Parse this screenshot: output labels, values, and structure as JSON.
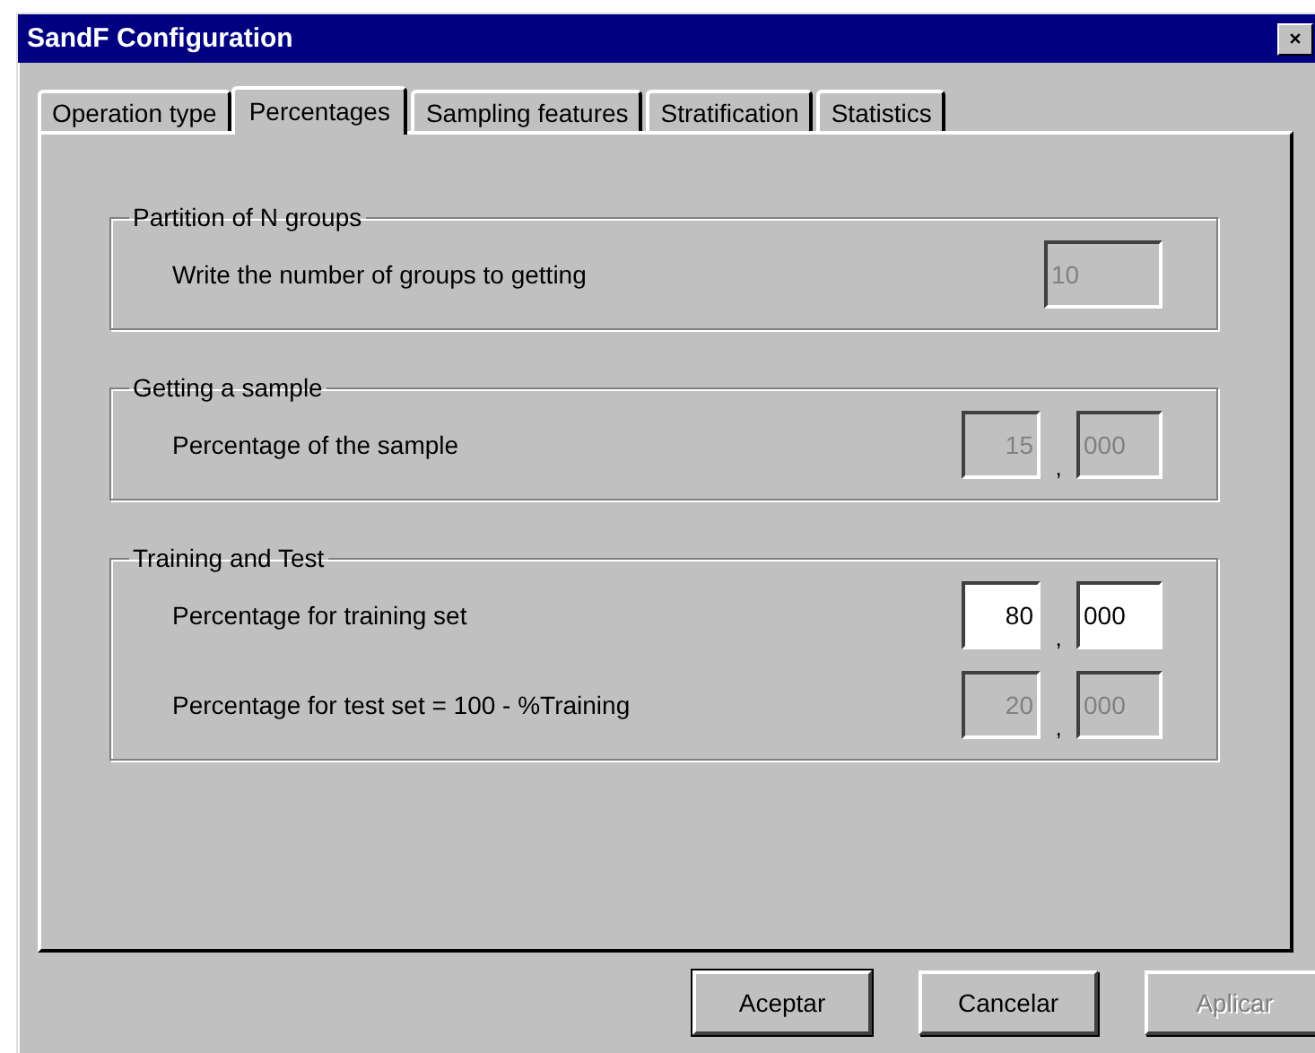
{
  "window": {
    "title": "SandF Configuration"
  },
  "tabs": [
    {
      "label": "Operation type",
      "selected": false
    },
    {
      "label": "Percentages",
      "selected": true
    },
    {
      "label": "Sampling features",
      "selected": false
    },
    {
      "label": "Stratification",
      "selected": false
    },
    {
      "label": "Statistics",
      "selected": false
    }
  ],
  "groups": [
    {
      "title": "Partition of N groups",
      "rows": [
        {
          "label": "Write the number of groups to getting",
          "kind": "single",
          "fields": [
            {
              "value": "10",
              "disabled": true
            }
          ]
        }
      ]
    },
    {
      "title": "Getting a sample",
      "rows": [
        {
          "label": "Percentage of the sample",
          "kind": "decimal",
          "separator": ",",
          "fields": [
            {
              "value": "15",
              "disabled": true
            },
            {
              "value": "000",
              "disabled": true
            }
          ]
        }
      ]
    },
    {
      "title": "Training and Test",
      "rows": [
        {
          "label": "Percentage for training set",
          "kind": "decimal",
          "separator": ",",
          "fields": [
            {
              "value": "80",
              "disabled": false
            },
            {
              "value": "000",
              "disabled": false
            }
          ]
        },
        {
          "label": "Percentage for test set = 100 -  %Training",
          "kind": "decimal",
          "separator": ",",
          "fields": [
            {
              "value": "20",
              "disabled": true
            },
            {
              "value": "000",
              "disabled": true
            }
          ]
        }
      ]
    }
  ],
  "buttons": [
    {
      "label": "Aceptar",
      "disabled": false,
      "default": true
    },
    {
      "label": "Cancelar",
      "disabled": false,
      "default": false
    },
    {
      "label": "Aplicar",
      "disabled": true,
      "default": false
    }
  ]
}
